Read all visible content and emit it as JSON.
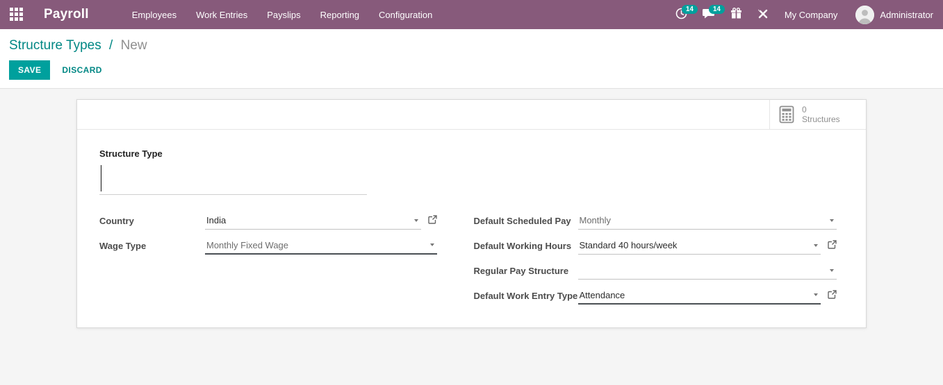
{
  "navbar": {
    "brand": "Payroll",
    "menu_items": [
      "Employees",
      "Work Entries",
      "Payslips",
      "Reporting",
      "Configuration"
    ],
    "activity_badge": "14",
    "messages_badge": "14",
    "company": "My Company",
    "user": "Administrator"
  },
  "breadcrumb": {
    "parent": "Structure Types",
    "separator": "/",
    "current": "New"
  },
  "actions": {
    "save": "SAVE",
    "discard": "DISCARD"
  },
  "stat_button": {
    "count": "0",
    "label": "Structures"
  },
  "form": {
    "fields": {
      "structure_type": {
        "label": "Structure Type",
        "value": ""
      },
      "country": {
        "label": "Country",
        "value": "India"
      },
      "wage_type": {
        "label": "Wage Type",
        "value": "Monthly Fixed Wage"
      },
      "default_scheduled_pay": {
        "label": "Default Scheduled Pay",
        "value": "Monthly"
      },
      "default_working_hours": {
        "label": "Default Working Hours",
        "value": "Standard 40 hours/week"
      },
      "regular_pay_structure": {
        "label": "Regular Pay Structure",
        "value": ""
      },
      "default_work_entry_type": {
        "label": "Default Work Entry Type",
        "value": "Attendance"
      }
    }
  },
  "colors": {
    "navbar_bg": "#875A7B",
    "accent_teal": "#00A09D",
    "link_teal": "#008784",
    "badge_bg": "#00A09D",
    "page_bg": "#f5f5f5",
    "required_underline": "#4a4f54"
  }
}
